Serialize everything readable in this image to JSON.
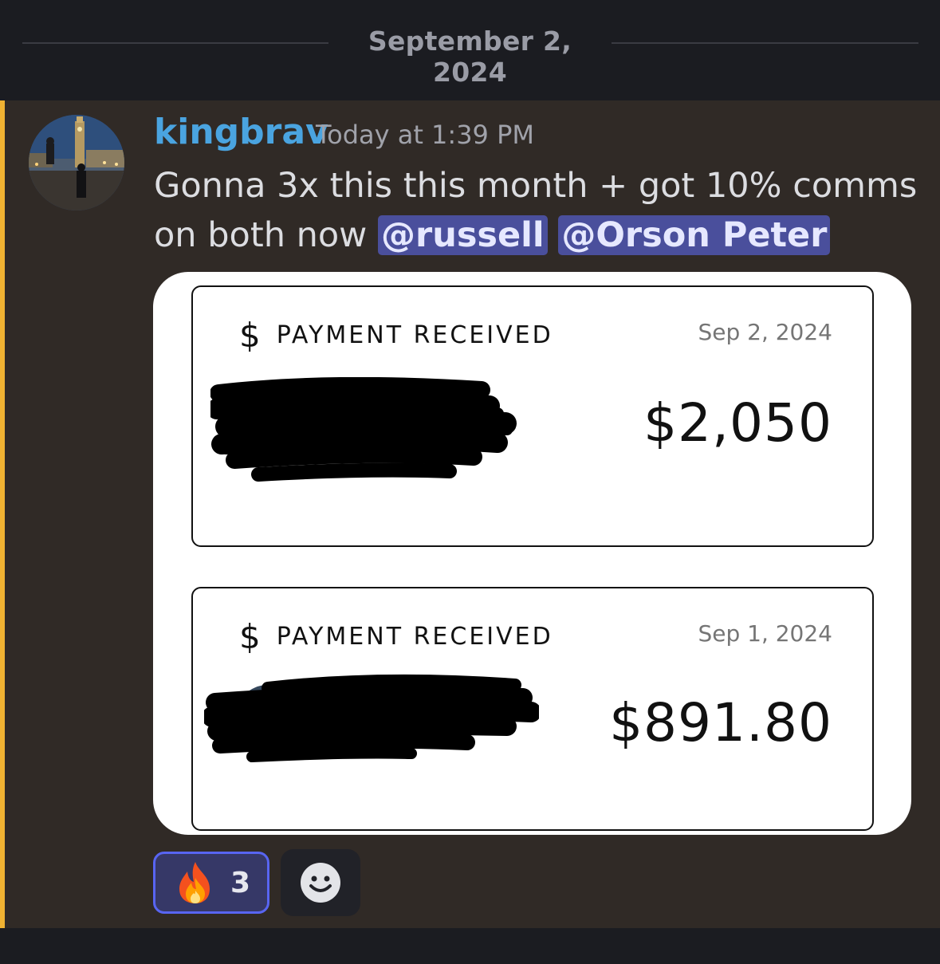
{
  "divider": {
    "date": "September 2, 2024"
  },
  "message": {
    "username": "kingbrav",
    "timestamp": "Today at 1:39 PM",
    "text": "Gonna 3x this this month + got 10% comms on both now",
    "mentions": [
      "@russell",
      "@Orson Peter"
    ]
  },
  "payments": [
    {
      "title": "PAYMENT RECEIVED",
      "date": "Sep 2, 2024",
      "amount": "$2,050",
      "icon": "dollar-sign-icon"
    },
    {
      "title": "PAYMENT RECEIVED",
      "date": "Sep 1, 2024",
      "amount": "$891.80",
      "icon": "dollar-sign-icon"
    }
  ],
  "reactions": [
    {
      "emoji": "fire-icon",
      "count": "3",
      "reacted": true
    }
  ],
  "add_reaction_icon": "smiley-add-reaction-icon",
  "colors": {
    "username": "#4aa4e0",
    "mention_bg": "#4a4f9c",
    "highlight_bar": "#f0b232",
    "reaction_border": "#5865f2"
  }
}
